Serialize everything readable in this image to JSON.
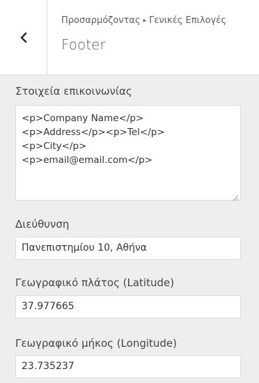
{
  "header": {
    "breadcrumb_parent": "Προσαρμόζοντας",
    "breadcrumb_separator": "▸",
    "breadcrumb_current": "Γενικές Επιλογές",
    "title": "Footer",
    "back_icon": "chevron-left-icon"
  },
  "contact": {
    "label": "Στοιχεία επικοινωνίας",
    "lines": [
      "<p>Company Name</p>",
      "<p>Address</p><p>Tel</p>",
      "<p>City</p>",
      "<p>email@email.com</p>"
    ]
  },
  "address": {
    "label": "Διεύθυνση",
    "value": "Πανεπιστημίου 10, Αθήνα"
  },
  "latitude": {
    "label": "Γεωγραφικό πλάτος (Latitude)",
    "value": "37.977665"
  },
  "longitude": {
    "label": "Γεωγραφικό μήκος (Longitude)",
    "value": "23.735237"
  }
}
